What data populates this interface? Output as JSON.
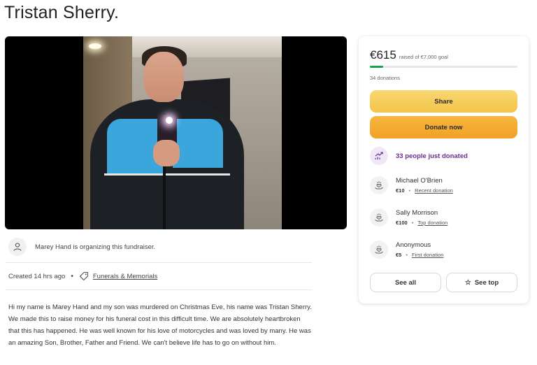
{
  "page": {
    "title": "Tristan Sherry."
  },
  "organizer": {
    "text": "Marey Hand is organizing this fundraiser.",
    "icon": "user-icon"
  },
  "meta": {
    "created": "Created 14 hrs ago",
    "separator": "•",
    "category": "Funerals & Memorials",
    "category_icon": "tag-icon"
  },
  "story": {
    "text": "Hi my name is Marey Hand and my son was murdered on Christmas Eve, his name was Tristan Sherry. We made this to raise money for his funeral cost in this difficult time. We are absolutely heartbroken that this has happened. He was well known for his love of motorcycles and was loved by many. He was an amazing Son, Brother, Father and Friend. We can't believe life has to go on without him."
  },
  "donation_card": {
    "raised_amount": "€615",
    "raised_goal_text": "raised of €7,000 goal",
    "progress_fraction": 0.088,
    "donation_count": "34 donations",
    "share_label": "Share",
    "donate_label": "Donate now",
    "just_donated": "33 people just donated",
    "donors": [
      {
        "name": "Michael O'Brien",
        "amount": "€10",
        "badge": "Recent donation"
      },
      {
        "name": "Sally Morrison",
        "amount": "€100",
        "badge": "Top donation"
      },
      {
        "name": "Anonymous",
        "amount": "€5",
        "badge": "First donation"
      }
    ],
    "see_all_label": "See all",
    "see_top_label": "See top",
    "see_top_icon": "star-icon"
  },
  "colors": {
    "progress": "#16a34a",
    "share_button": "#f3c549",
    "donate_button": "#f2a126",
    "accent_purple": "#6b2c91"
  }
}
